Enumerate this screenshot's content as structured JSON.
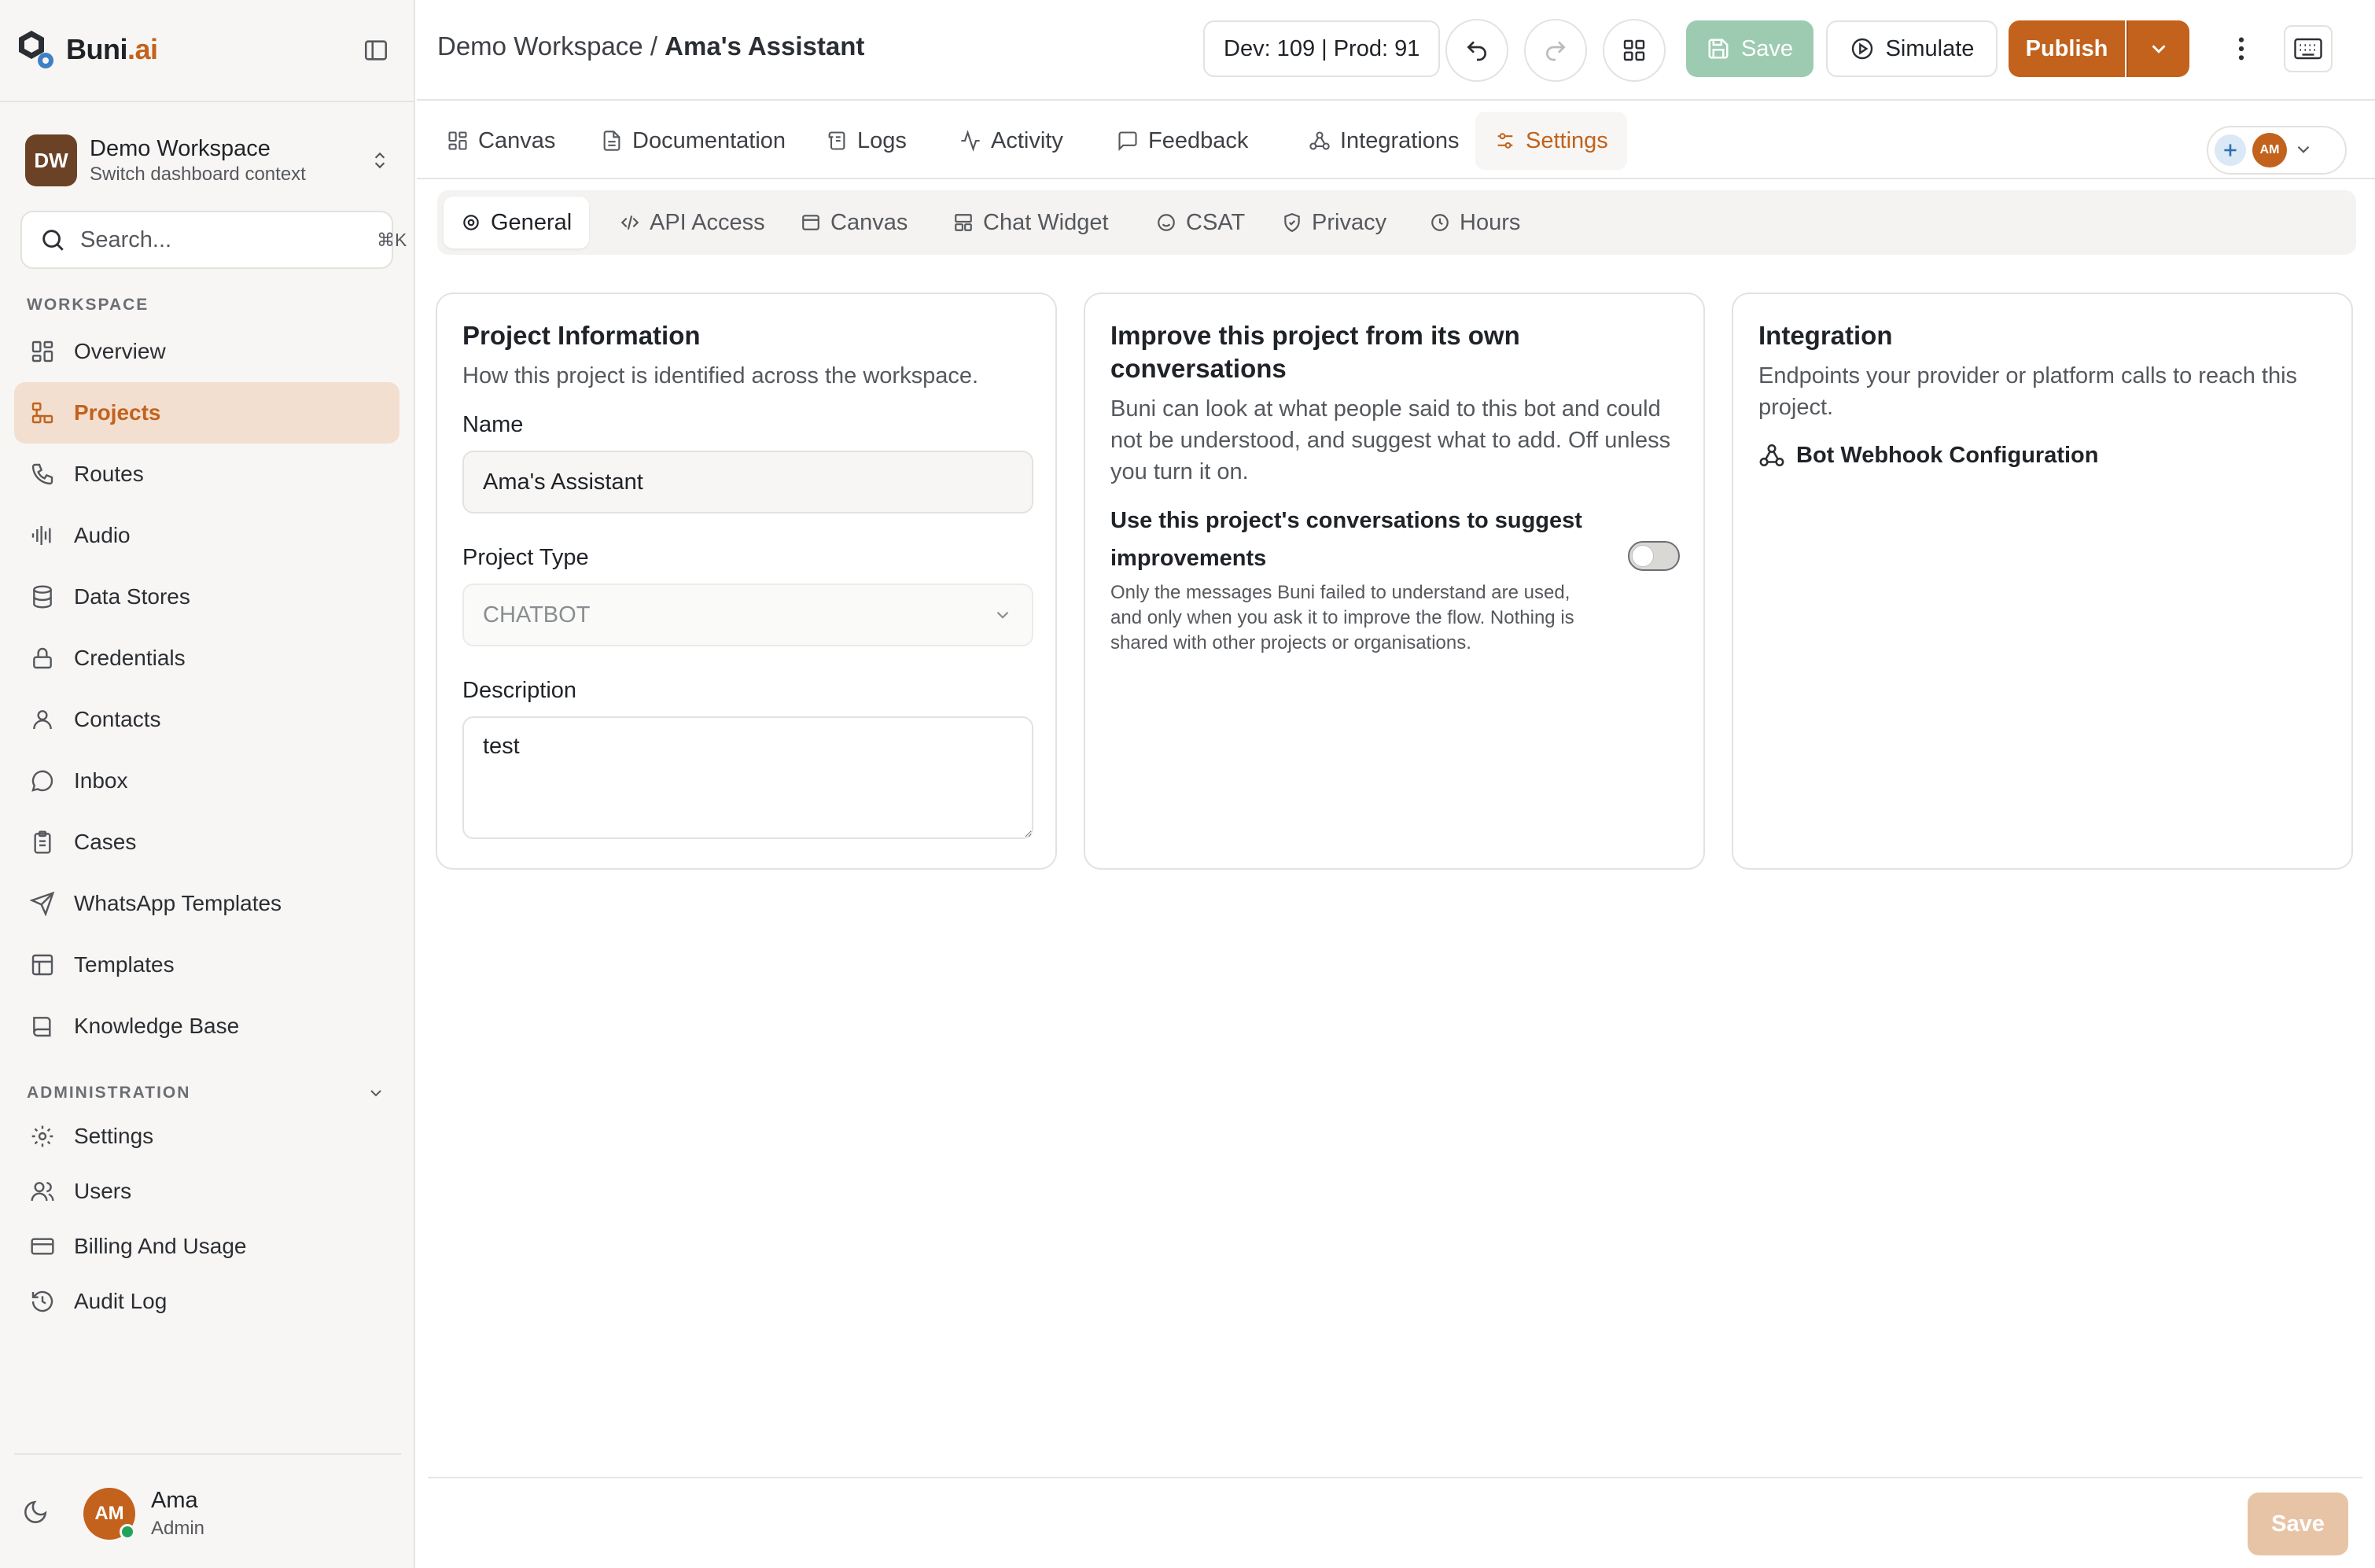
{
  "brand": {
    "name_main": "Buni",
    "name_suffix": ".ai"
  },
  "workspace_switcher": {
    "initials": "DW",
    "name": "Demo Workspace",
    "subtitle": "Switch dashboard context"
  },
  "search": {
    "placeholder": "Search...",
    "shortcut": "⌘K"
  },
  "sidebar": {
    "workspace_label": "WORKSPACE",
    "workspace_items": [
      {
        "label": "Overview",
        "icon": "grid-icon"
      },
      {
        "label": "Projects",
        "icon": "workflow-icon",
        "active": true
      },
      {
        "label": "Routes",
        "icon": "phone-icon"
      },
      {
        "label": "Audio",
        "icon": "audio-waveform-icon"
      },
      {
        "label": "Data Stores",
        "icon": "database-icon"
      },
      {
        "label": "Credentials",
        "icon": "lock-icon"
      },
      {
        "label": "Contacts",
        "icon": "user-icon"
      },
      {
        "label": "Inbox",
        "icon": "message-circle-icon"
      },
      {
        "label": "Cases",
        "icon": "clipboard-icon"
      },
      {
        "label": "WhatsApp Templates",
        "icon": "send-icon"
      },
      {
        "label": "Templates",
        "icon": "layout-icon"
      },
      {
        "label": "Knowledge Base",
        "icon": "book-icon"
      }
    ],
    "admin_label": "ADMINISTRATION",
    "admin_items": [
      {
        "label": "Settings",
        "icon": "gear-icon"
      },
      {
        "label": "Users",
        "icon": "users-icon"
      },
      {
        "label": "Billing And Usage",
        "icon": "credit-card-icon"
      },
      {
        "label": "Audit Log",
        "icon": "history-icon"
      }
    ]
  },
  "user": {
    "initials": "AM",
    "name": "Ama",
    "role": "Admin"
  },
  "topbar": {
    "breadcrumb_parent": "Demo Workspace",
    "breadcrumb_sep": " / ",
    "breadcrumb_current": "Ama's Assistant",
    "version_counter": "Dev: 109 | Prod: 91",
    "save_label": "Save",
    "simulate_label": "Simulate",
    "publish_label": "Publish"
  },
  "tabs": [
    {
      "label": "Canvas",
      "icon": "grid-icon"
    },
    {
      "label": "Documentation",
      "icon": "file-icon"
    },
    {
      "label": "Logs",
      "icon": "scroll-icon"
    },
    {
      "label": "Activity",
      "icon": "activity-icon"
    },
    {
      "label": "Feedback",
      "icon": "message-square-icon"
    },
    {
      "label": "Integrations",
      "icon": "webhook-icon"
    },
    {
      "label": "Settings",
      "icon": "settings-icon",
      "active": true
    }
  ],
  "collaborators": {
    "initials": "AM"
  },
  "subtabs": [
    {
      "label": "General",
      "icon": "gear-icon",
      "active": true
    },
    {
      "label": "API Access",
      "icon": "code-icon"
    },
    {
      "label": "Canvas",
      "icon": "layout-icon"
    },
    {
      "label": "Chat Widget",
      "icon": "widget-icon"
    },
    {
      "label": "CSAT",
      "icon": "smile-icon"
    },
    {
      "label": "Privacy",
      "icon": "shield-check-icon"
    },
    {
      "label": "Hours",
      "icon": "clock-icon"
    }
  ],
  "project_info": {
    "title": "Project Information",
    "description": "How this project is identified across the workspace.",
    "name_label": "Name",
    "name_value": "Ama's Assistant",
    "type_label": "Project Type",
    "type_value": "CHATBOT",
    "desc_label": "Description",
    "desc_value": "test"
  },
  "improve": {
    "title": "Improve this project from its own conversations",
    "description": "Buni can look at what people said to this bot and could not be understood, and suggest what to add. Off unless you turn it on.",
    "toggle_label": "Use this project's conversations to suggest improvements",
    "toggle_help": "Only the messages Buni failed to understand are used, and only when you ask it to improve the flow. Nothing is shared with other projects or organisations.",
    "toggle_on": false
  },
  "integration": {
    "title": "Integration",
    "description": "Endpoints your provider or platform calls to reach this project.",
    "webhook_label": "Bot Webhook Configuration"
  },
  "footer": {
    "save_label": "Save"
  },
  "colors": {
    "accent": "#c2621c",
    "save_disabled": "#9ccbb1",
    "active_bg": "#f2dfd0"
  }
}
